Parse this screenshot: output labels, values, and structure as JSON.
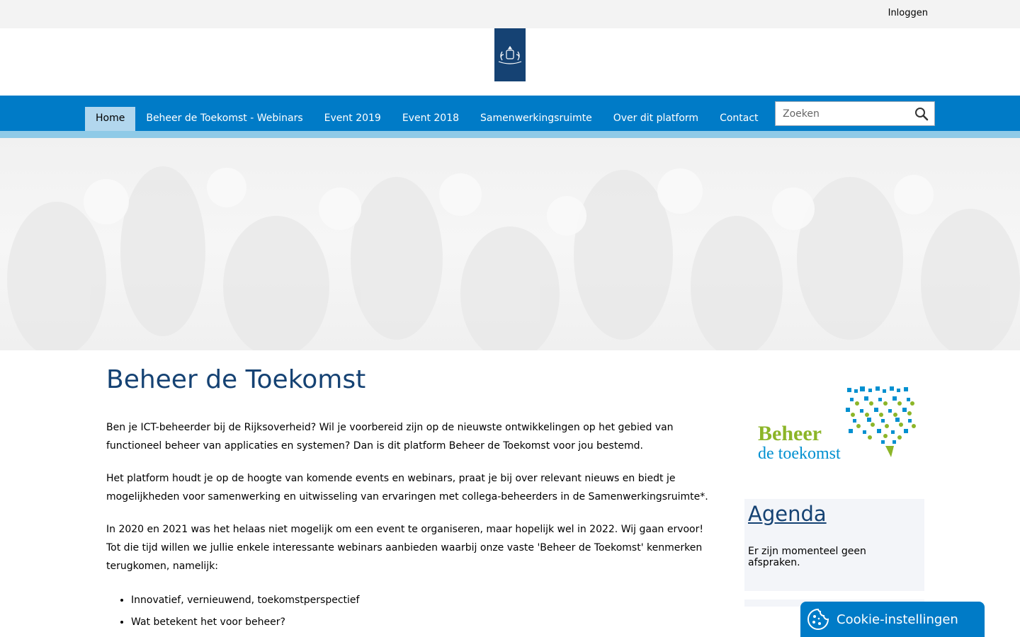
{
  "topbar": {
    "login_label": "Inloggen"
  },
  "header": {
    "logo_icon": "rijksoverheid-coat-of-arms-icon"
  },
  "nav": {
    "items": [
      {
        "label": "Home",
        "active": true
      },
      {
        "label": "Beheer de Toekomst - Webinars"
      },
      {
        "label": "Event 2019"
      },
      {
        "label": "Event 2018"
      },
      {
        "label": "Samenwerkingsruimte"
      },
      {
        "label": "Over dit platform"
      },
      {
        "label": "Contact"
      }
    ],
    "search_placeholder": "Zoeken"
  },
  "main": {
    "title": "Beheer de Toekomst",
    "para1": "Ben je ICT-beheerder bij de Rijksoverheid? Wil je voorbereid zijn op de nieuwste ontwikkelingen op het gebied van functioneel beheer van applicaties en systemen? Dan is dit platform Beheer de Toekomst voor jou bestemd.",
    "para2": "Het platform houdt je op de hoogte van komende events en webinars, praat je bij over relevant nieuws en biedt je mogelijkheden voor samenwerking en uitwisseling van ervaringen met collega-beheerders in de Samenwerkingsruimte*.",
    "para3_line1": "In 2020 en 2021 was het helaas niet mogelijk om een event te organiseren,  maar hopelijk wel in 2022. Wij gaan ervoor!",
    "para3_line2": "Tot die tijd willen we jullie enkele interessante webinars aanbieden waarbij onze vaste 'Beheer de Toekomst' kenmerken terugkomen, namelijk:",
    "bullets": [
      "Innovatief, vernieuwend, toekomstperspectief",
      "Wat betekent het voor beheer?"
    ]
  },
  "sidebar": {
    "logo_line1": "Beheer",
    "logo_line2": "de toekomst",
    "agenda_title": "Agenda",
    "agenda_text": "Er zijn momenteel geen afspraken."
  },
  "cookie": {
    "label": "Cookie-instellingen"
  },
  "colors": {
    "brand": "#154273",
    "nav": "#007bc7",
    "nav_strip": "#8fcae7",
    "green": "#8cb528",
    "blue": "#0090d0"
  }
}
